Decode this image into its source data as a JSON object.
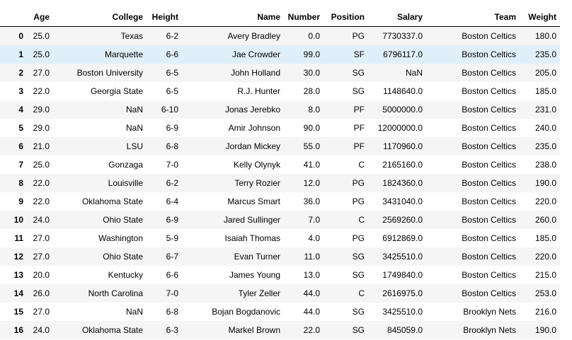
{
  "table": {
    "columns": [
      "",
      "Age",
      "College",
      "Height",
      "Name",
      "Number",
      "Position",
      "Salary",
      "Team",
      "Weight"
    ],
    "rows": [
      [
        "0",
        "25.0",
        "Texas",
        "6-2",
        "Avery Bradley",
        "0.0",
        "PG",
        "7730337.0",
        "Boston Celtics",
        "180.0"
      ],
      [
        "1",
        "25.0",
        "Marquette",
        "6-6",
        "Jae Crowder",
        "99.0",
        "SF",
        "6796117.0",
        "Boston Celtics",
        "235.0"
      ],
      [
        "2",
        "27.0",
        "Boston University",
        "6-5",
        "John Holland",
        "30.0",
        "SG",
        "NaN",
        "Boston Celtics",
        "205.0"
      ],
      [
        "3",
        "22.0",
        "Georgia State",
        "6-5",
        "R.J. Hunter",
        "28.0",
        "SG",
        "1148640.0",
        "Boston Celtics",
        "185.0"
      ],
      [
        "4",
        "29.0",
        "NaN",
        "6-10",
        "Jonas Jerebko",
        "8.0",
        "PF",
        "5000000.0",
        "Boston Celtics",
        "231.0"
      ],
      [
        "5",
        "29.0",
        "NaN",
        "6-9",
        "Amir Johnson",
        "90.0",
        "PF",
        "12000000.0",
        "Boston Celtics",
        "240.0"
      ],
      [
        "6",
        "21.0",
        "LSU",
        "6-8",
        "Jordan Mickey",
        "55.0",
        "PF",
        "1170960.0",
        "Boston Celtics",
        "235.0"
      ],
      [
        "7",
        "25.0",
        "Gonzaga",
        "7-0",
        "Kelly Olynyk",
        "41.0",
        "C",
        "2165160.0",
        "Boston Celtics",
        "238.0"
      ],
      [
        "8",
        "22.0",
        "Louisville",
        "6-2",
        "Terry Rozier",
        "12.0",
        "PG",
        "1824360.0",
        "Boston Celtics",
        "190.0"
      ],
      [
        "9",
        "22.0",
        "Oklahoma State",
        "6-4",
        "Marcus Smart",
        "36.0",
        "PG",
        "3431040.0",
        "Boston Celtics",
        "220.0"
      ],
      [
        "10",
        "24.0",
        "Ohio State",
        "6-9",
        "Jared Sullinger",
        "7.0",
        "C",
        "2569260.0",
        "Boston Celtics",
        "260.0"
      ],
      [
        "11",
        "27.0",
        "Washington",
        "5-9",
        "Isaiah Thomas",
        "4.0",
        "PG",
        "6912869.0",
        "Boston Celtics",
        "185.0"
      ],
      [
        "12",
        "27.0",
        "Ohio State",
        "6-7",
        "Evan Turner",
        "11.0",
        "SG",
        "3425510.0",
        "Boston Celtics",
        "220.0"
      ],
      [
        "13",
        "20.0",
        "Kentucky",
        "6-6",
        "James Young",
        "13.0",
        "SG",
        "1749840.0",
        "Boston Celtics",
        "215.0"
      ],
      [
        "14",
        "26.0",
        "North Carolina",
        "7-0",
        "Tyler Zeller",
        "44.0",
        "C",
        "2616975.0",
        "Boston Celtics",
        "253.0"
      ],
      [
        "15",
        "27.0",
        "NaN",
        "6-8",
        "Bojan Bogdanovic",
        "44.0",
        "SG",
        "3425510.0",
        "Brooklyn Nets",
        "216.0"
      ],
      [
        "16",
        "24.0",
        "Oklahoma State",
        "6-3",
        "Markel Brown",
        "22.0",
        "SG",
        "845059.0",
        "Brooklyn Nets",
        "190.0"
      ]
    ],
    "hovered_row": 1,
    "colors": {
      "stripe": "#f5f5f5",
      "hover": "#e1effa",
      "rule": "#000000",
      "text": "#000000"
    }
  }
}
